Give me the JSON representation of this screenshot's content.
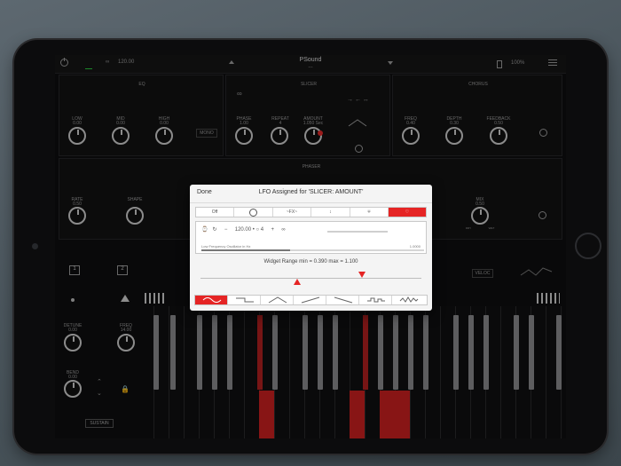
{
  "topbar": {
    "bpm": "120.00",
    "app_title": "PSound",
    "preset": "---",
    "battery": "100%"
  },
  "eq": {
    "title": "EQ",
    "knobs": [
      {
        "label": "LOW",
        "value": "0.00"
      },
      {
        "label": "MID",
        "value": "0.00"
      },
      {
        "label": "HIGH",
        "value": "0.00"
      }
    ],
    "mono": "MONO"
  },
  "slicer": {
    "title": "SLICER",
    "knobs": [
      {
        "label": "PHASE",
        "value": "1.00"
      },
      {
        "label": "REPEAT",
        "value": "4"
      },
      {
        "label": "AMOUNT",
        "value": "1.050 Sec"
      }
    ]
  },
  "chorus": {
    "title": "CHORUS",
    "knobs": [
      {
        "label": "FREQ",
        "value": "0.40"
      },
      {
        "label": "DEPTH",
        "value": "0.30"
      },
      {
        "label": "FEEDBACK",
        "value": "0.50"
      }
    ]
  },
  "phaser": {
    "title": "PHASER",
    "knobs": [
      {
        "label": "RATE",
        "value": "0.50"
      },
      {
        "label": "SHAPE",
        "value": ""
      },
      {
        "label": "MIX",
        "value": "0.50"
      }
    ],
    "mix_min": "DRY",
    "mix_max": "WET"
  },
  "left_controls": {
    "detune_label": "DETUNE",
    "detune_value": "0.00",
    "freq_label": "FREQ",
    "freq_value": "14.00",
    "bend_label": "BEND",
    "bend_value": "0.00",
    "page1": "1",
    "page2": "2",
    "sustain": "SUSTAIN",
    "velo": "VELOC"
  },
  "modal": {
    "done": "Done",
    "title": "LFO Assigned for 'SLICER: AMOUNT'",
    "segments": [
      "Off",
      "",
      "~FX~",
      "",
      "",
      ""
    ],
    "selected_segment": 5,
    "tempo_row": "120.00 • ○ 4",
    "lfo_label": "Low Frequency Oscillator in Hz",
    "lfo_value": "1.0000",
    "range_text": "Widget Range min = 0.390 max = 1.100",
    "range_min": 0.39,
    "range_max": 1.1,
    "shapes": [
      "sine",
      "square",
      "triangle",
      "saw-up",
      "saw-down",
      "random",
      "noise"
    ],
    "selected_shape": 0,
    "accent": "#e52424"
  }
}
